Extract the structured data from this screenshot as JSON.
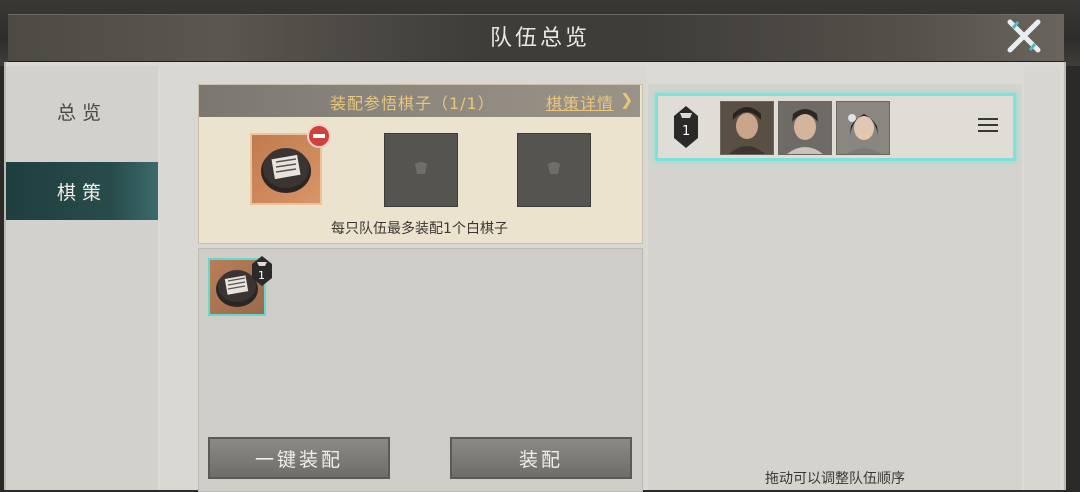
{
  "window": {
    "title": "队伍总览"
  },
  "sidebar": {
    "items": [
      {
        "label": "总览",
        "active": false
      },
      {
        "label": "棋策",
        "active": true
      }
    ]
  },
  "equip": {
    "title": "装配参悟棋子（1/1）",
    "detail_link": "棋策详情",
    "limit_text": "每只队伍最多装配1个白棋子",
    "slots": [
      "filled",
      "empty",
      "empty"
    ]
  },
  "inventory": {
    "items": [
      {
        "icon": "chess-piece-icon",
        "count": "1"
      }
    ]
  },
  "buttons": {
    "auto_equip": "一键装配",
    "equip": "装配"
  },
  "team": {
    "number": "1",
    "members": [
      "hero-portrait-1",
      "hero-portrait-2",
      "hero-portrait-3"
    ]
  },
  "hint": "拖动可以调整队伍顺序",
  "colors": {
    "accent_teal": "#7fe2da",
    "gold_text": "#e9c67a",
    "active_tab": "#284c4c"
  }
}
